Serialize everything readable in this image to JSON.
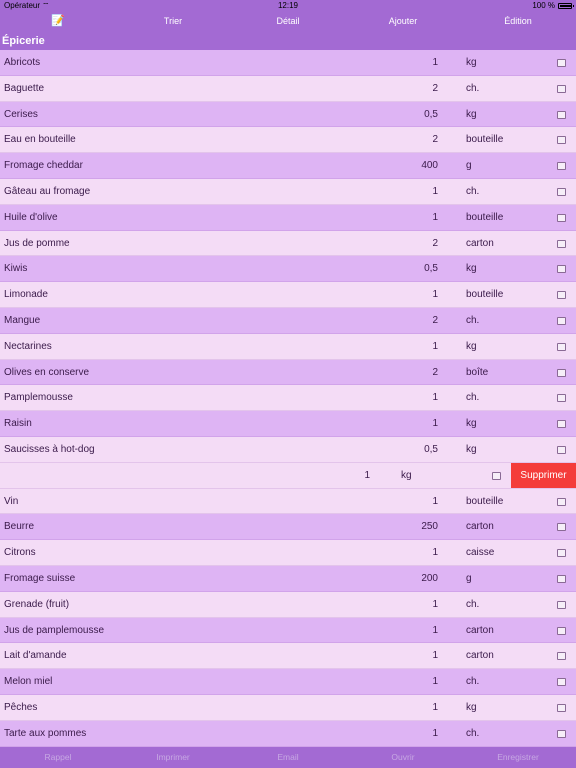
{
  "status": {
    "carrier": "Opérateur",
    "time": "12:19",
    "battery": "100 %"
  },
  "toolbar": {
    "note_icon": "note-pencil-icon",
    "sort": "Trier",
    "detail": "Détail",
    "add": "Ajouter",
    "edit": "Édition"
  },
  "section": {
    "title": "Épicerie"
  },
  "items": [
    {
      "name": "Abricots",
      "qty": "1",
      "unit": "kg"
    },
    {
      "name": "Baguette",
      "qty": "2",
      "unit": "ch."
    },
    {
      "name": "Cerises",
      "qty": "0,5",
      "unit": "kg"
    },
    {
      "name": "Eau en bouteille",
      "qty": "2",
      "unit": "bouteille"
    },
    {
      "name": "Fromage cheddar",
      "qty": "400",
      "unit": "g"
    },
    {
      "name": "Gâteau au fromage",
      "qty": "1",
      "unit": "ch."
    },
    {
      "name": "Huile d'olive",
      "qty": "1",
      "unit": "bouteille"
    },
    {
      "name": "Jus de pomme",
      "qty": "2",
      "unit": "carton"
    },
    {
      "name": "Kiwis",
      "qty": "0,5",
      "unit": "kg"
    },
    {
      "name": "Limonade",
      "qty": "1",
      "unit": "bouteille"
    },
    {
      "name": "Mangue",
      "qty": "2",
      "unit": "ch."
    },
    {
      "name": "Nectarines",
      "qty": "1",
      "unit": "kg"
    },
    {
      "name": "Olives en conserve",
      "qty": "2",
      "unit": "boîte"
    },
    {
      "name": "Pamplemousse",
      "qty": "1",
      "unit": "ch."
    },
    {
      "name": "Raisin",
      "qty": "1",
      "unit": "kg"
    },
    {
      "name": "Saucisses à hot-dog",
      "qty": "0,5",
      "unit": "kg"
    },
    {
      "name": "",
      "qty": "1",
      "unit": "kg",
      "swiped": true,
      "delete_label": "Supprimer"
    },
    {
      "name": "Vin",
      "qty": "1",
      "unit": "bouteille"
    },
    {
      "name": "Beurre",
      "qty": "250",
      "unit": "carton"
    },
    {
      "name": "Citrons",
      "qty": "1",
      "unit": "caisse"
    },
    {
      "name": "Fromage suisse",
      "qty": "200",
      "unit": "g"
    },
    {
      "name": "Grenade (fruit)",
      "qty": "1",
      "unit": "ch."
    },
    {
      "name": "Jus de pamplemousse",
      "qty": "1",
      "unit": "carton"
    },
    {
      "name": "Lait d'amande",
      "qty": "1",
      "unit": "carton"
    },
    {
      "name": "Melon miel",
      "qty": "1",
      "unit": "ch."
    },
    {
      "name": "Pêches",
      "qty": "1",
      "unit": "kg"
    },
    {
      "name": "Tarte aux pommes",
      "qty": "1",
      "unit": "ch."
    }
  ],
  "bottom": {
    "reminder": "Rappel",
    "print": "Imprimer",
    "email": "Email",
    "open": "Ouvrir",
    "save": "Enregistrer"
  },
  "colors": {
    "accent": "#a36ad3",
    "row_dark": "#deb4f4",
    "row_light": "#f4dcf6",
    "delete": "#f43c3a"
  }
}
